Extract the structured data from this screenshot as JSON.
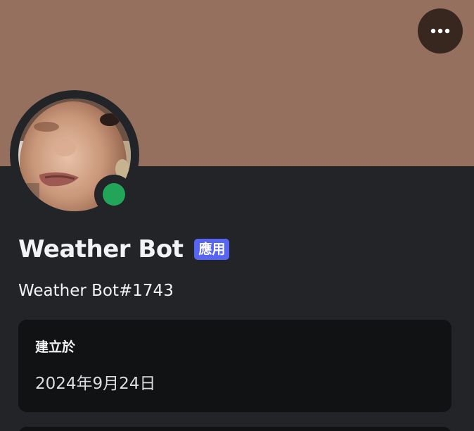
{
  "profile": {
    "display_name": "Weather Bot",
    "badge": "應用",
    "username": "Weather Bot#1743",
    "status": "online",
    "avatar": "user-avatar-photo"
  },
  "header": {
    "more_icon": "more-horizontal-icon"
  },
  "info": {
    "title": "建立於",
    "value": "2024年9月24日"
  },
  "colors": {
    "banner": "#95705F",
    "background": "#232428",
    "card": "#111214",
    "badge": "#5865F2",
    "status_online": "#23A559",
    "text_primary": "#F2F3F5"
  }
}
